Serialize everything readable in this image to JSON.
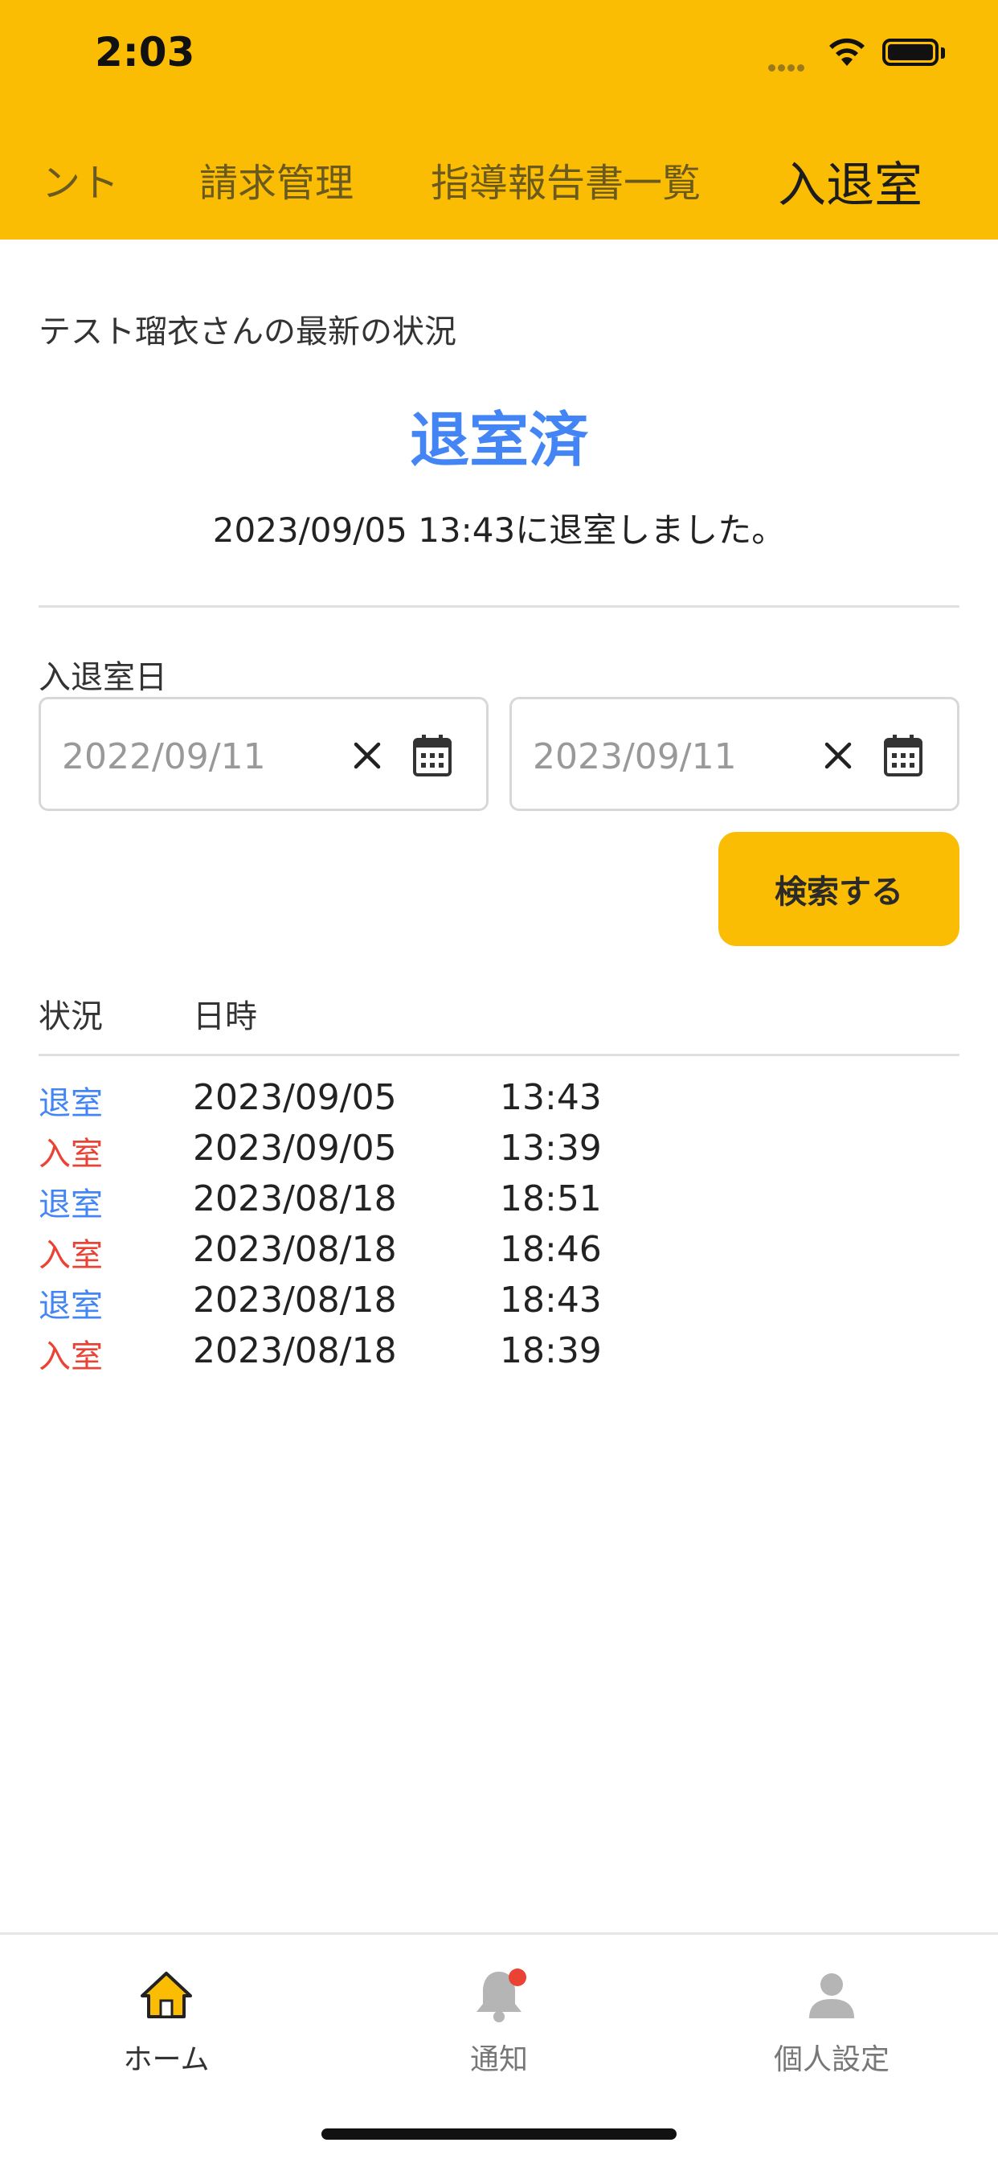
{
  "status_bar": {
    "time": "2:03"
  },
  "tabs": [
    {
      "label": "ント",
      "active": false
    },
    {
      "label": "請求管理",
      "active": false
    },
    {
      "label": "指導報告書一覧",
      "active": false
    },
    {
      "label": "入退室",
      "active": true
    }
  ],
  "latest": {
    "label": "テスト瑠衣さんの最新の状況",
    "status": "退室済",
    "message": "2023/09/05 13:43に退室しました。"
  },
  "filter": {
    "label": "入退室日",
    "from_placeholder": "2022/09/11",
    "to_placeholder": "2023/09/11",
    "search_label": "検索する"
  },
  "table": {
    "headers": {
      "status": "状況",
      "datetime": "日時"
    },
    "rows": [
      {
        "status": "退室",
        "type": "out",
        "date": "2023/09/05",
        "time": "13:43"
      },
      {
        "status": "入室",
        "type": "in",
        "date": "2023/09/05",
        "time": "13:39"
      },
      {
        "status": "退室",
        "type": "out",
        "date": "2023/08/18",
        "time": "18:51"
      },
      {
        "status": "入室",
        "type": "in",
        "date": "2023/08/18",
        "time": "18:46"
      },
      {
        "status": "退室",
        "type": "out",
        "date": "2023/08/18",
        "time": "18:43"
      },
      {
        "status": "入室",
        "type": "in",
        "date": "2023/08/18",
        "time": "18:39"
      }
    ]
  },
  "bottom_nav": [
    {
      "label": "ホーム",
      "icon": "home-icon",
      "active": true
    },
    {
      "label": "通知",
      "icon": "bell-icon",
      "active": false,
      "badge": true
    },
    {
      "label": "個人設定",
      "icon": "person-icon",
      "active": false
    }
  ],
  "colors": {
    "accent": "#FBBC04",
    "out_status": "#4385F4",
    "in_status": "#EA4335"
  }
}
